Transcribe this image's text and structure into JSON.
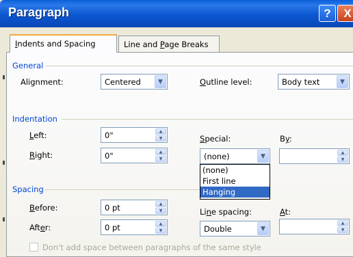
{
  "window": {
    "title": "Paragraph",
    "help_glyph": "?",
    "close_glyph": "X"
  },
  "tabs": [
    {
      "pre": "",
      "key": "I",
      "post": "ndents and Spacing",
      "active": true
    },
    {
      "pre": "Line and ",
      "key": "P",
      "post": "age Breaks",
      "active": false
    }
  ],
  "general": {
    "heading": "General",
    "alignment_label": "Alignment:",
    "alignment_value": "Centered",
    "outline_label_key": "O",
    "outline_label_rest": "utline level:",
    "outline_value": "Body text"
  },
  "indentation": {
    "heading": "Indentation",
    "left_key": "L",
    "left_rest": "eft:",
    "left_value": "0\"",
    "right_key": "R",
    "right_rest": "ight:",
    "right_value": "0\"",
    "special_key": "S",
    "special_rest": "pecial:",
    "by_pre": "B",
    "by_key": "y",
    "by_rest": ":",
    "special_value": "(none)",
    "by_value": "",
    "special_options": [
      "(none)",
      "First line",
      "Hanging"
    ],
    "special_highlighted": "Hanging"
  },
  "spacing": {
    "heading": "Spacing",
    "before_key": "B",
    "before_rest": "efore:",
    "before_value": "0 pt",
    "after_pre": "Aft",
    "after_key": "e",
    "after_rest": "r:",
    "after_value": "0 pt",
    "line_pre": "Li",
    "line_key": "n",
    "line_rest": "e spacing:",
    "line_value": "Double",
    "at_key": "A",
    "at_rest": "t:",
    "at_value": "",
    "no_space_checkbox_label": "Don't add space between paragraphs of the same style",
    "no_space_checked": false
  },
  "icons": {
    "dropdown": "▼",
    "spin_up": "▲",
    "spin_down": "▼"
  }
}
